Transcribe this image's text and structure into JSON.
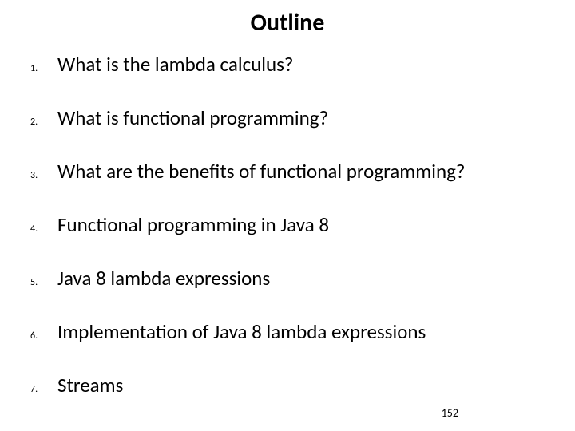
{
  "title": "Outline",
  "items": [
    {
      "num": "1.",
      "text": "What is the lambda calculus?"
    },
    {
      "num": "2.",
      "text": "What is functional programming?"
    },
    {
      "num": "3.",
      "text": "What are the benefits of functional programming?"
    },
    {
      "num": "4.",
      "text": "Functional programming in Java 8"
    },
    {
      "num": "5.",
      "text": "Java 8 lambda expressions"
    },
    {
      "num": "6.",
      "text": "Implementation of Java 8 lambda expressions"
    },
    {
      "num": "7.",
      "text": "Streams"
    }
  ],
  "pageNumber": "152"
}
